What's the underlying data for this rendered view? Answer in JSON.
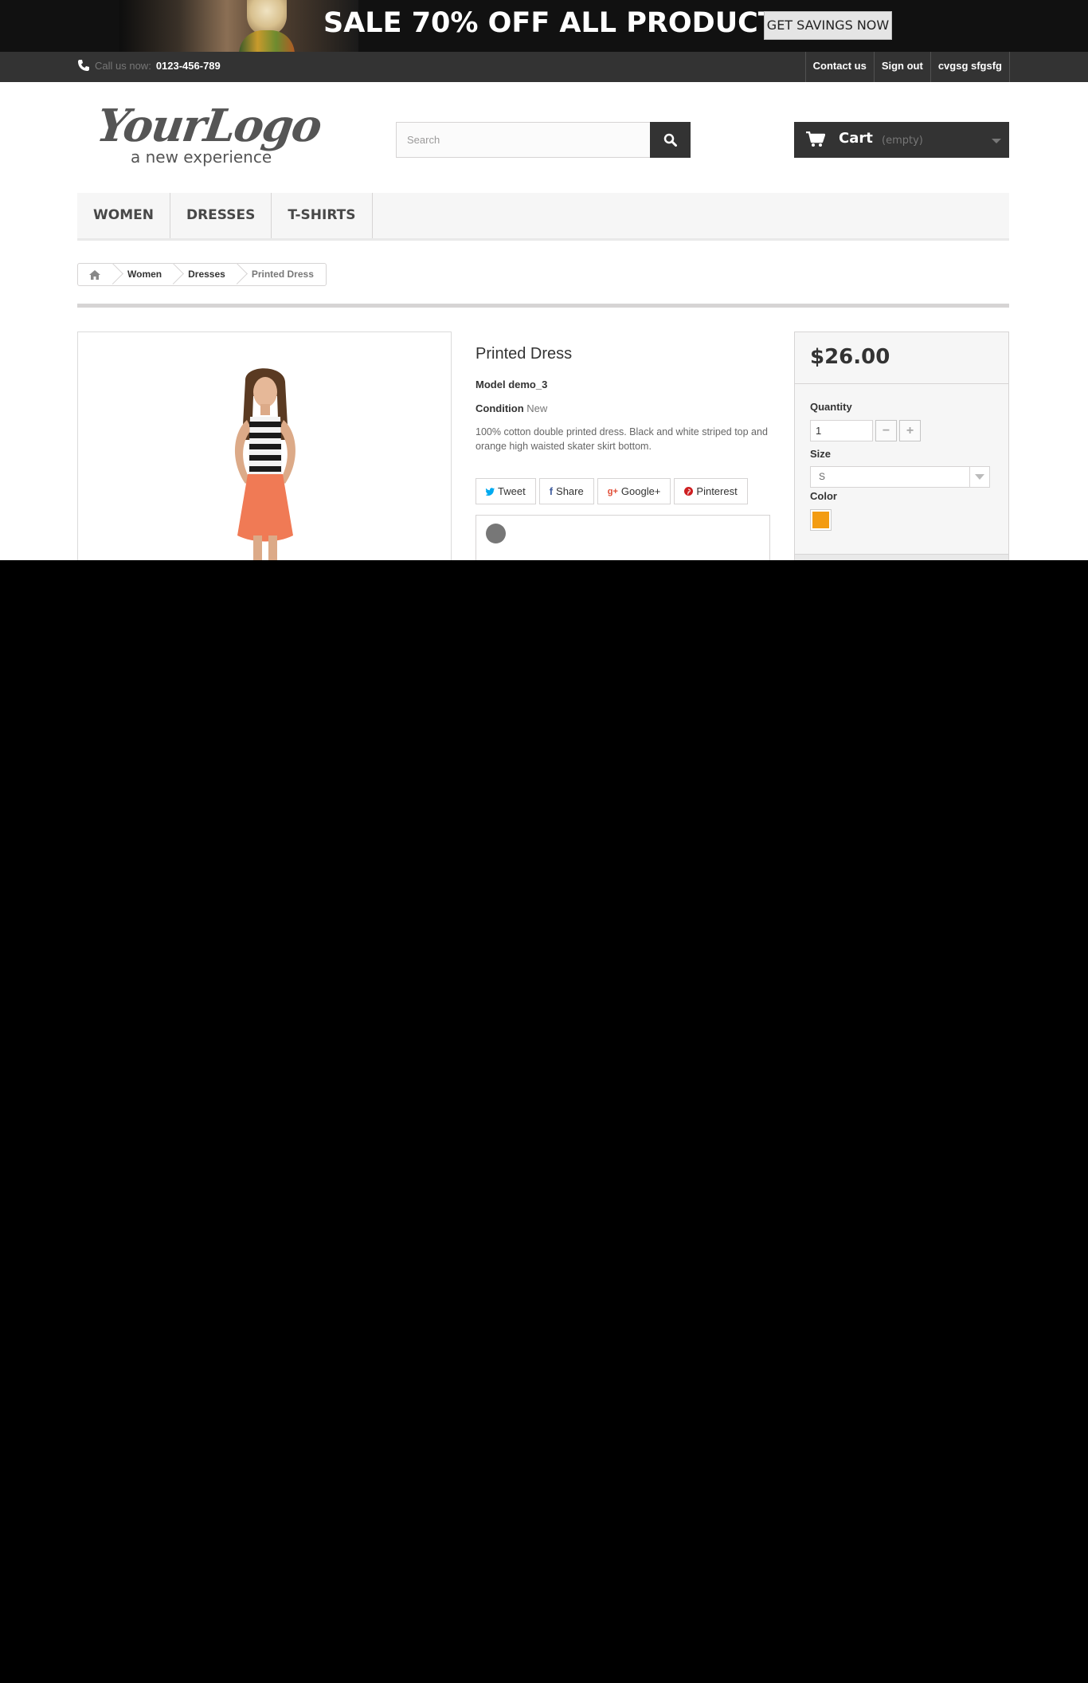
{
  "banner": {
    "headline": "SALE 70% OFF ALL PRODUCTS",
    "cta": "GET SAVINGS NOW"
  },
  "topbar": {
    "phone_label": "Call us now:",
    "phone_number": "0123-456-789",
    "links": [
      "Contact us",
      "Sign out",
      "cvgsg sfgsfg"
    ]
  },
  "logo": {
    "text": "YourLogo",
    "tagline": "a new experience"
  },
  "search": {
    "placeholder": "Search",
    "value": ""
  },
  "cart": {
    "label": "Cart",
    "status": "(empty)"
  },
  "menu": [
    "WOMEN",
    "DRESSES",
    "T-SHIRTS"
  ],
  "breadcrumb": [
    "Women",
    "Dresses",
    "Printed Dress"
  ],
  "product": {
    "name": "Printed Dress",
    "model_label": "Model",
    "model_value": "demo_3",
    "condition_label": "Condition",
    "condition_value": "New",
    "description": "100% cotton double printed dress. Black and white striped top and orange high waisted skater skirt bottom.",
    "social": [
      "Tweet",
      "Share",
      "Google+",
      "Pinterest"
    ]
  },
  "buy": {
    "price": "$26.00",
    "quantity_label": "Quantity",
    "quantity_value": "1",
    "size_label": "Size",
    "size_value": "S",
    "color_label": "Color",
    "color_swatch": "#f39c11"
  },
  "colors": {
    "dark": "#333333",
    "accent_orange": "#f39c11"
  }
}
